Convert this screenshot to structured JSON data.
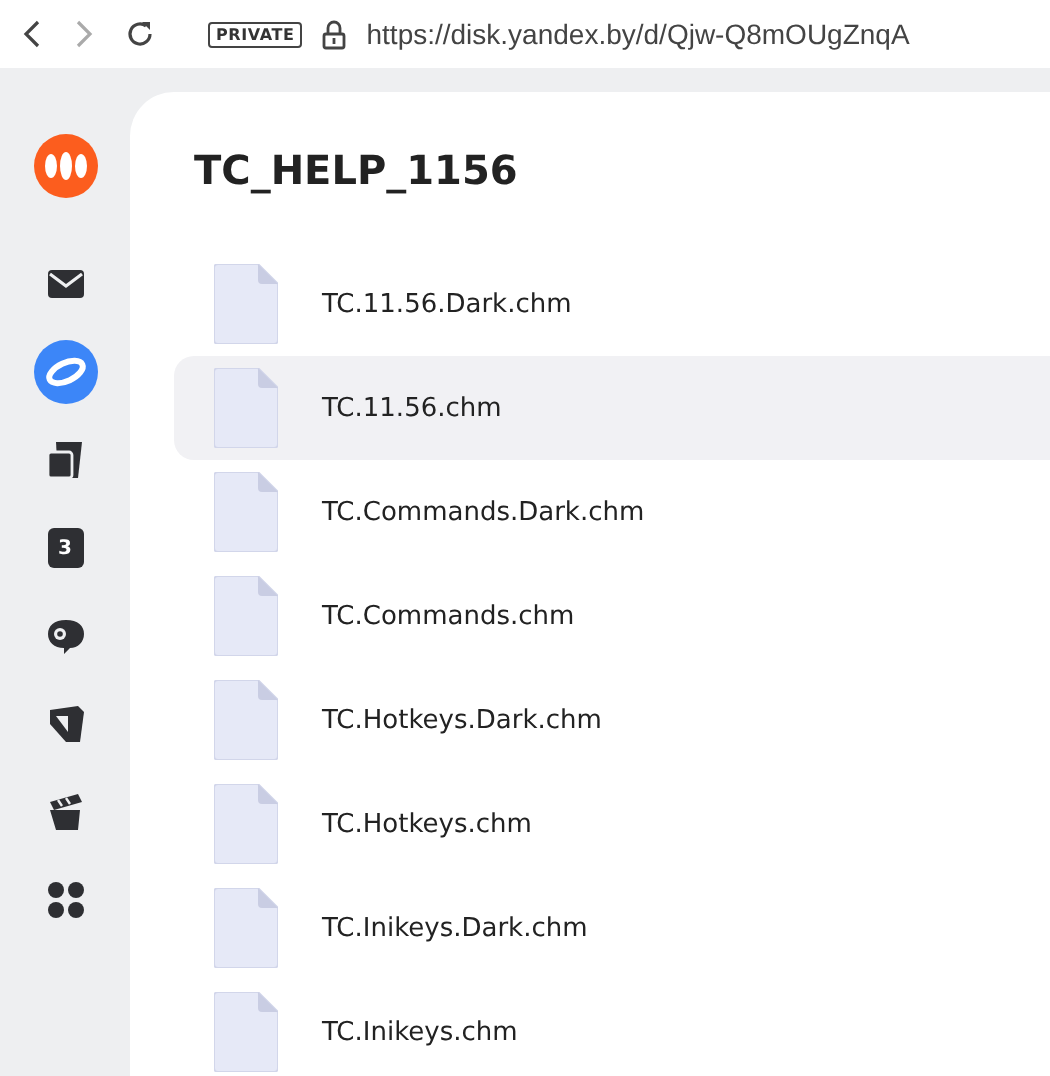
{
  "browser": {
    "private_badge": "PRIVATE",
    "url": "https://disk.yandex.by/d/Qjw-Q8mOUgZnqA"
  },
  "sidebar": {
    "items": [
      {
        "kind": "logo"
      },
      {
        "kind": "mail"
      },
      {
        "kind": "disk"
      },
      {
        "kind": "docs"
      },
      {
        "kind": "calendar",
        "day": "3"
      },
      {
        "kind": "chat"
      },
      {
        "kind": "notes"
      },
      {
        "kind": "clapper"
      },
      {
        "kind": "apps"
      }
    ]
  },
  "folder": {
    "title": "TC_HELP_1156",
    "files": [
      {
        "name": "TC.11.56.Dark.chm",
        "selected": false
      },
      {
        "name": "TC.11.56.chm",
        "selected": true
      },
      {
        "name": "TC.Commands.Dark.chm",
        "selected": false
      },
      {
        "name": "TC.Commands.chm",
        "selected": false
      },
      {
        "name": "TC.Hotkeys.Dark.chm",
        "selected": false
      },
      {
        "name": "TC.Hotkeys.chm",
        "selected": false
      },
      {
        "name": "TC.Inikeys.Dark.chm",
        "selected": false
      },
      {
        "name": "TC.Inikeys.chm",
        "selected": false
      }
    ]
  }
}
